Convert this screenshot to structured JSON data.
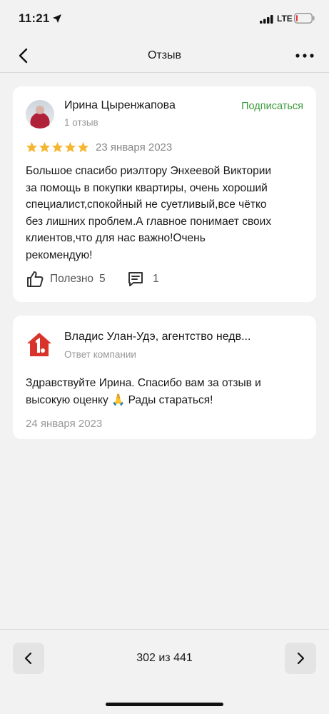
{
  "status_bar": {
    "time": "11:21",
    "network": "LTE",
    "battery_level": 0.1,
    "battery_color": "#e53935"
  },
  "nav": {
    "title": "Отзыв",
    "back_icon": "chevron-left-icon",
    "more_icon": "more-horizontal-icon"
  },
  "review": {
    "author_name": "Ирина Цыренжапова",
    "author_reviews": "1 отзыв",
    "subscribe_label": "Подписаться",
    "rating": 5,
    "rating_max": 5,
    "star_color": "#f5b731",
    "date": "23 января 2023",
    "text": "Большое спасибо риэлтору Энхеевой Виктории\nза помощь в покупки квартиры, очень хороший\nспециалист,спокойный не суетливый,все чётко\nбез лишних проблем.А главное понимает своих\nклиентов,что для нас важно!Очень\nрекомендую!",
    "useful_label": "Полезно",
    "useful_count": "5",
    "comments_count": "1"
  },
  "reply": {
    "company_name": "Владис Улан-Удэ, агентство недв...",
    "company_sub": "Ответ компании",
    "text": "Здравствуйте Ирина. Спасибо вам за отзыв и\nвысокую оценку 🙏 Рады стараться!",
    "date": "24 января 2023",
    "logo_color": "#d9342b"
  },
  "pager": {
    "label": "302 из 441"
  },
  "colors": {
    "accent_green": "#3a9a3a",
    "background": "#f2f2f2"
  }
}
